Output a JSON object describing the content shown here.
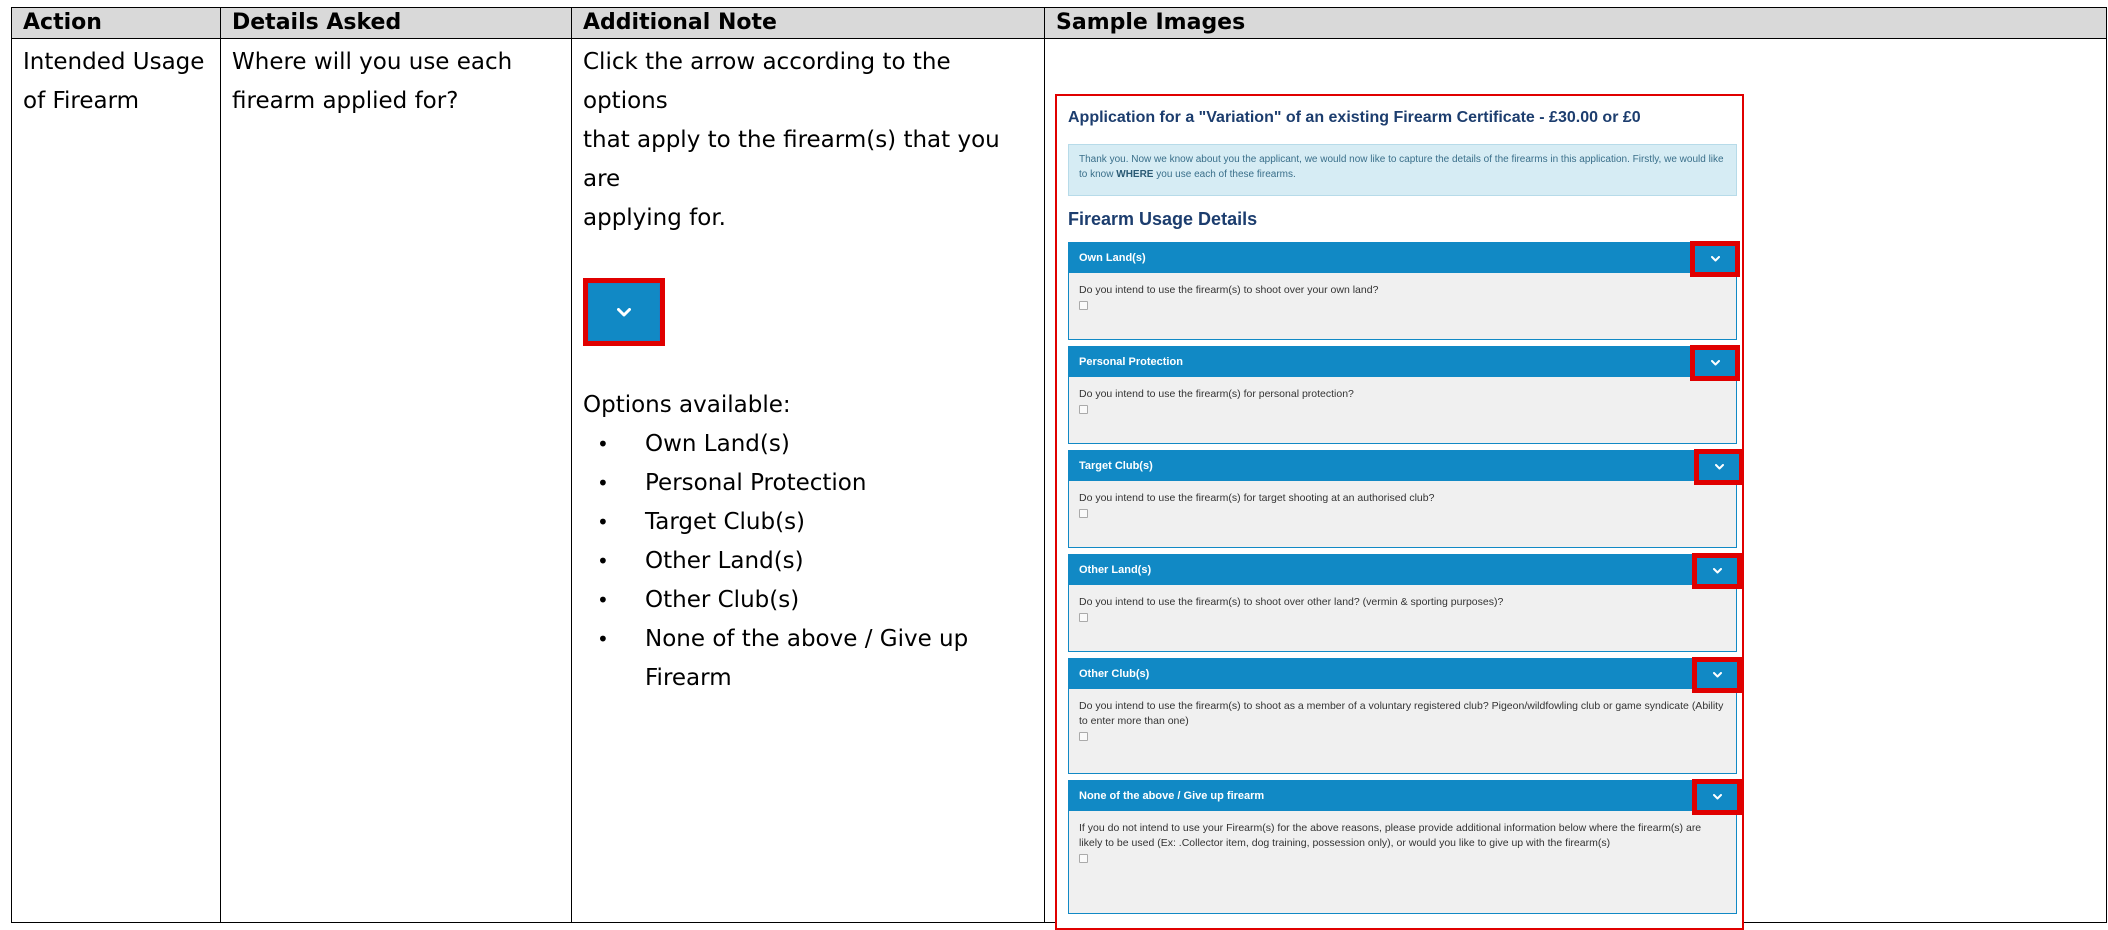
{
  "headers": {
    "action": "Action",
    "details": "Details Asked",
    "note": "Additional Note",
    "sample": "Sample Images"
  },
  "row": {
    "action_line1": "Intended Usage",
    "action_line2": "of Firearm",
    "details_line1": "Where will you use each",
    "details_line2": "firearm applied for?",
    "note_line1": "Click the arrow according to the options",
    "note_line2": "that apply to the firearm(s) that you are",
    "note_line3": "applying for.",
    "options_heading": "Options available:",
    "options": [
      "Own Land(s)",
      "Personal Protection",
      "Target Club(s)",
      "Other Land(s)",
      "Other Club(s)",
      "None of the above / Give up",
      "Firearm"
    ],
    "bullet": "•"
  },
  "form": {
    "title": "Application for a \"Variation\" of an existing Firearm Certificate - £30.00 or £0",
    "info_pre": "Thank you. Now we know about you the applicant, we would now like to capture the details of the firearms in this application. Firstly, we would like to know ",
    "info_bold": "WHERE",
    "info_post": " you use each of these firearms.",
    "section_title": "Firearm Usage Details",
    "panels": [
      {
        "title": "Own Land(s)",
        "question": "Do you intend to use the firearm(s) to shoot over your own land?"
      },
      {
        "title": "Personal Protection",
        "question": "Do you intend to use the firearm(s) for personal protection?"
      },
      {
        "title": "Target Club(s)",
        "question": "Do you intend to use the firearm(s) for target shooting at an authorised club?"
      },
      {
        "title": "Other Land(s)",
        "question": "Do you intend to use the firearm(s) to shoot over other land? (vermin & sporting purposes)?"
      },
      {
        "title": "Other Club(s)",
        "question": "Do you intend to use the firearm(s) to shoot as a member of a voluntary registered club? Pigeon/wildfowling club or game syndicate (Ability to enter more than one)"
      },
      {
        "title": "None of the above / Give up firearm",
        "question": "If you do not intend to use your Firearm(s) for the above reasons, please provide additional information below where the firearm(s) are likely to be used (Ex: .Collector item, dog training, possession only), or would you like to give up with the firearm(s)"
      }
    ]
  },
  "colors": {
    "panel_blue": "#1189c5",
    "highlight_red": "#e00000",
    "header_gray": "#d9d9d9",
    "title_navy": "#1c3d6e"
  },
  "icons": {
    "toggle": "chevron-down-icon"
  }
}
